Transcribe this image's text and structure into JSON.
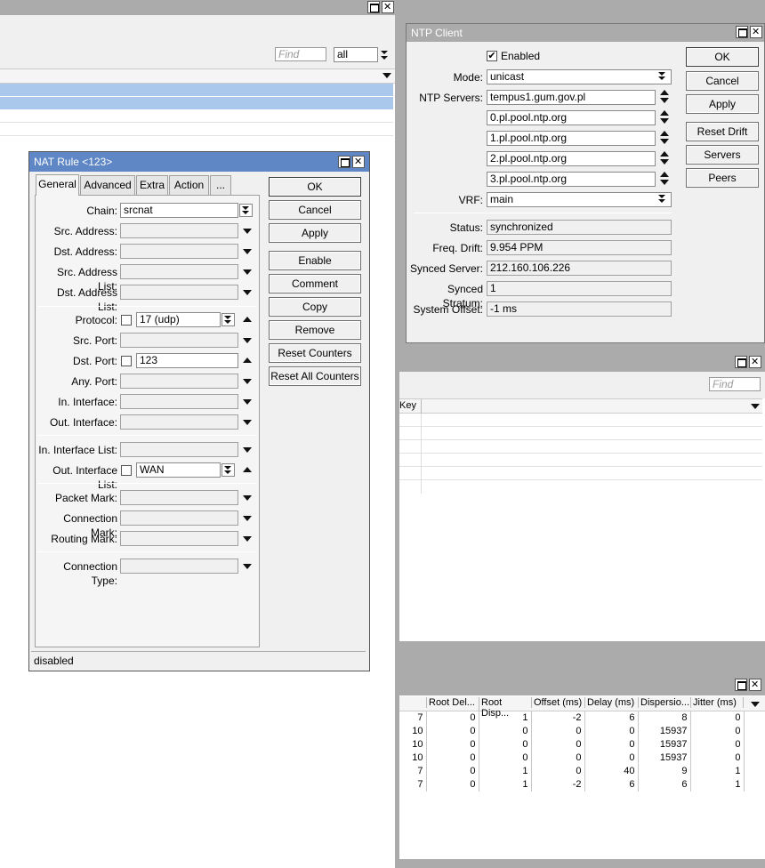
{
  "bg_window": {
    "find_placeholder": "Find",
    "filter_value": "all"
  },
  "nat_rule": {
    "title": "NAT Rule <123>",
    "tabs": [
      "General",
      "Advanced",
      "Extra",
      "Action",
      "..."
    ],
    "active_tab": "General",
    "labels": {
      "chain": "Chain:",
      "src_address": "Src. Address:",
      "dst_address": "Dst. Address:",
      "src_address_list": "Src. Address List:",
      "dst_address_list": "Dst. Address List:",
      "protocol": "Protocol:",
      "src_port": "Src. Port:",
      "dst_port": "Dst. Port:",
      "any_port": "Any. Port:",
      "in_interface": "In. Interface:",
      "out_interface": "Out. Interface:",
      "in_interface_list": "In. Interface List:",
      "out_interface_list": "Out. Interface List:",
      "packet_mark": "Packet Mark:",
      "connection_mark": "Connection Mark:",
      "routing_mark": "Routing Mark:",
      "connection_type": "Connection Type:"
    },
    "values": {
      "chain": "srcnat",
      "protocol": "17 (udp)",
      "dst_port": "123",
      "out_interface_list": "WAN"
    },
    "buttons": {
      "ok": "OK",
      "cancel": "Cancel",
      "apply": "Apply",
      "enable": "Enable",
      "comment": "Comment",
      "copy": "Copy",
      "remove": "Remove",
      "reset_counters": "Reset Counters",
      "reset_all_counters": "Reset All Counters"
    },
    "status": "disabled"
  },
  "ntp_client": {
    "title": "NTP Client",
    "enabled_label": "Enabled",
    "enabled": true,
    "labels": {
      "mode": "Mode:",
      "ntp_servers": "NTP Servers:",
      "vrf": "VRF:",
      "status": "Status:",
      "freq_drift": "Freq. Drift:",
      "synced_server": "Synced Server:",
      "synced_stratum": "Synced Stratum:",
      "system_offset": "System Offset:"
    },
    "mode": "unicast",
    "servers": [
      "tempus1.gum.gov.pl",
      "0.pl.pool.ntp.org",
      "1.pl.pool.ntp.org",
      "2.pl.pool.ntp.org",
      "3.pl.pool.ntp.org"
    ],
    "vrf": "main",
    "status": "synchronized",
    "freq_drift": "9.954 PPM",
    "synced_server": "212.160.106.226",
    "synced_stratum": "1",
    "system_offset": "-1 ms",
    "buttons": {
      "ok": "OK",
      "cancel": "Cancel",
      "apply": "Apply",
      "reset_drift": "Reset Drift",
      "servers": "Servers",
      "peers": "Peers"
    }
  },
  "keys_window": {
    "find_placeholder": "Find",
    "column_partial": "Key"
  },
  "peers_table": {
    "columns": [
      "Root Del...",
      "Root Disp...",
      "Offset (ms)",
      "Delay (ms)",
      "Dispersio...",
      "Jitter (ms)"
    ],
    "rows": [
      [
        "7",
        "0",
        "1",
        "-2",
        "6",
        "8",
        "0"
      ],
      [
        "10",
        "0",
        "0",
        "0",
        "0",
        "15937",
        "0"
      ],
      [
        "10",
        "0",
        "0",
        "0",
        "0",
        "15937",
        "0"
      ],
      [
        "10",
        "0",
        "0",
        "0",
        "0",
        "15937",
        "0"
      ],
      [
        "7",
        "0",
        "1",
        "0",
        "40",
        "9",
        "1"
      ],
      [
        "7",
        "0",
        "1",
        "-2",
        "6",
        "6",
        "1"
      ]
    ]
  }
}
